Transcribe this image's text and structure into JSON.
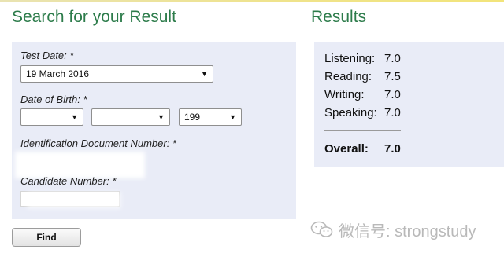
{
  "search": {
    "title": "Search for your Result",
    "test_date_label": "Test Date: *",
    "test_date_value": "19 March 2016",
    "dob_label": "Date of Birth: *",
    "dob_year_value": "199",
    "id_label": "Identification Document Number: *",
    "candidate_label": "Candidate Number: *",
    "find_label": "Find"
  },
  "results": {
    "title": "Results",
    "scores": [
      {
        "name": "Listening:",
        "value": "7.0"
      },
      {
        "name": "Reading:",
        "value": "7.5"
      },
      {
        "name": "Writing:",
        "value": "7.0"
      },
      {
        "name": "Speaking:",
        "value": "7.0"
      }
    ],
    "overall_label": "Overall:",
    "overall_value": "7.0"
  },
  "watermark": {
    "text": "微信号: strongstudy",
    "icon": "wechat-icon"
  },
  "colors": {
    "title_green": "#2d7c4b",
    "panel_bg": "#e9ecf7",
    "top_line": "#efe38c"
  }
}
